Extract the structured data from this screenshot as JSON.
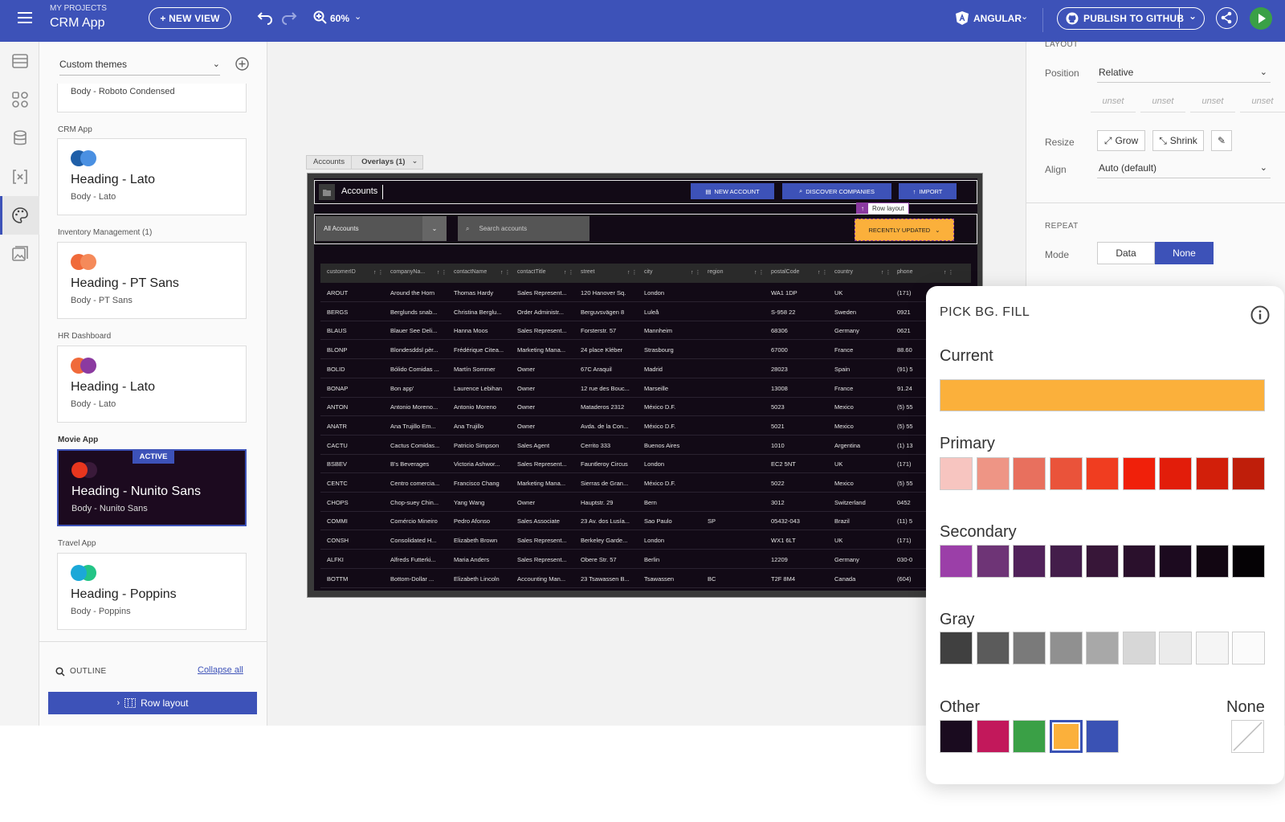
{
  "header": {
    "project_label": "MY PROJECTS",
    "app_name": "CRM App",
    "new_view": "+ NEW VIEW",
    "zoom": "60%",
    "framework": "ANGULAR",
    "publish": "PUBLISH TO GITHUB"
  },
  "left_panel": {
    "theme_select": "Custom themes",
    "partial_card_body": "Body - Roboto Condensed",
    "themes": [
      {
        "label": "CRM App",
        "heading": "Heading - Lato",
        "body": "Body - Lato",
        "c1": "#1f5fa8",
        "c2": "#4a90e2"
      },
      {
        "label": "Inventory Management (1)",
        "heading": "Heading - PT Sans",
        "body": "Body - PT Sans",
        "c1": "#f06a3a",
        "c2": "#f58a5a"
      },
      {
        "label": "HR Dashboard",
        "heading": "Heading - Lato",
        "body": "Body - Lato",
        "c1": "#f06a3a",
        "c2": "#8b3aa0"
      },
      {
        "label": "Movie App",
        "heading": "Heading - Nunito Sans",
        "body": "Body - Nunito Sans",
        "c1": "#e8361e",
        "c2": "#3a1a3a",
        "badge": "ACTIVE"
      },
      {
        "label": "Travel App",
        "heading": "Heading - Poppins",
        "body": "Body - Poppins",
        "c1": "#1ba8d8",
        "c2": "#23c486"
      }
    ],
    "outline_label": "OUTLINE",
    "collapse_all": "Collapse all",
    "row_layout": "Row layout"
  },
  "canvas": {
    "breadcrumb_1": "Accounts",
    "breadcrumb_2": "Overlays (1)",
    "app_title": "Accounts",
    "new_account": "NEW ACCOUNT",
    "discover": "DISCOVER COMPANIES",
    "import": "IMPORT",
    "row_layout_tag": "Row layout",
    "filter_select": "All Accounts",
    "search_placeholder": "Search accounts",
    "recently_updated": "RECENTLY UPDATED",
    "columns": [
      "customerID",
      "companyNa...",
      "contactName",
      "contactTitle",
      "street",
      "city",
      "region",
      "postalCode",
      "country",
      "phone"
    ],
    "rows": [
      [
        "AROUT",
        "Around the Horn",
        "Thomas Hardy",
        "Sales Represent...",
        "120 Hanover Sq.",
        "London",
        "",
        "WA1 1DP",
        "UK",
        "(171)"
      ],
      [
        "BERGS",
        "Berglunds snab...",
        "Christina Berglu...",
        "Order Administr...",
        "Berguvsvägen 8",
        "Luleå",
        "",
        "S-958 22",
        "Sweden",
        "0921"
      ],
      [
        "BLAUS",
        "Blauer See Deli...",
        "Hanna Moos",
        "Sales Represent...",
        "Forsterstr. 57",
        "Mannheim",
        "",
        "68306",
        "Germany",
        "0621"
      ],
      [
        "BLONP",
        "Blondesddsl pèr...",
        "Frédérique Citea...",
        "Marketing Mana...",
        "24 place Kléber",
        "Strasbourg",
        "",
        "67000",
        "France",
        "88.60"
      ],
      [
        "BOLID",
        "Bólido Comidas ...",
        "Martín Sommer",
        "Owner",
        "67C Araquil",
        "Madrid",
        "",
        "28023",
        "Spain",
        "(91) 5"
      ],
      [
        "BONAP",
        "Bon app'",
        "Laurence Lebihan",
        "Owner",
        "12 rue des Bouc...",
        "Marseille",
        "",
        "13008",
        "France",
        "91.24"
      ],
      [
        "ANTON",
        "Antonio Moreno...",
        "Antonio Moreno",
        "Owner",
        "Mataderos 2312",
        "México D.F.",
        "",
        "5023",
        "Mexico",
        "(5) 55"
      ],
      [
        "ANATR",
        "Ana Trujillo Em...",
        "Ana Trujillo",
        "Owner",
        "Avda. de la Con...",
        "México D.F.",
        "",
        "5021",
        "Mexico",
        "(5) 55"
      ],
      [
        "CACTU",
        "Cactus Comidas...",
        "Patricio Simpson",
        "Sales Agent",
        "Cerrito 333",
        "Buenos Aires",
        "",
        "1010",
        "Argentina",
        "(1) 13"
      ],
      [
        "BSBEV",
        "B's Beverages",
        "Victoria Ashwor...",
        "Sales Represent...",
        "Fauntleroy Circus",
        "London",
        "",
        "EC2 5NT",
        "UK",
        "(171)"
      ],
      [
        "CENTC",
        "Centro comercia...",
        "Francisco Chang",
        "Marketing Mana...",
        "Sierras de Gran...",
        "México D.F.",
        "",
        "5022",
        "Mexico",
        "(5) 55"
      ],
      [
        "CHOPS",
        "Chop-suey Chin...",
        "Yang Wang",
        "Owner",
        "Hauptstr. 29",
        "Bern",
        "",
        "3012",
        "Switzerland",
        "0452"
      ],
      [
        "COMMI",
        "Comércio Mineiro",
        "Pedro Afonso",
        "Sales Associate",
        "23 Av. dos Lusía...",
        "Sao Paulo",
        "SP",
        "05432-043",
        "Brazil",
        "(11) 5"
      ],
      [
        "CONSH",
        "Consolidated H...",
        "Elizabeth Brown",
        "Sales Represent...",
        "Berkeley Garde...",
        "London",
        "",
        "WX1 6LT",
        "UK",
        "(171)"
      ],
      [
        "ALFKI",
        "Alfreds Futterki...",
        "Maria Anders",
        "Sales Represent...",
        "Obere Str. 57",
        "Berlin",
        "",
        "12209",
        "Germany",
        "030-0"
      ],
      [
        "BOTTM",
        "Bottom-Dollar ...",
        "Elizabeth Lincoln",
        "Accounting Man...",
        "23 Tsawassen B...",
        "Tsawassen",
        "BC",
        "T2F 8M4",
        "Canada",
        "(604)"
      ]
    ]
  },
  "right_panel": {
    "layout_label": "LAYOUT",
    "position_label": "Position",
    "position_value": "Relative",
    "unset": [
      "unset",
      "unset",
      "unset",
      "unset"
    ],
    "resize_label": "Resize",
    "grow": "Grow",
    "shrink": "Shrink",
    "align_label": "Align",
    "align_value": "Auto (default)",
    "repeat_label": "REPEAT",
    "mode_label": "Mode",
    "mode_data": "Data",
    "mode_none": "None"
  },
  "popover": {
    "title": "PICK BG. FILL",
    "current_label": "Current",
    "current_color": "#fbb03b",
    "primary_label": "Primary",
    "secondary_label": "Secondary",
    "gray_label": "Gray",
    "other_label": "Other",
    "none_label": "None",
    "primary": [
      "#f7c5c0",
      "#ee9585",
      "#e8705e",
      "#ea533a",
      "#f03d20",
      "#f0200a",
      "#e21d0a",
      "#d21f0a",
      "#bf1e0a"
    ],
    "secondary": [
      "#9b3fa8",
      "#6e3476",
      "#51225a",
      "#431d4a",
      "#371638",
      "#2a102c",
      "#1c0a1f",
      "#120612",
      "#050205"
    ],
    "gray": [
      "#404040",
      "#5b5b5b",
      "#7a7a7a",
      "#909090",
      "#a8a8a8",
      "#d7d7d7",
      "#ebebeb",
      "#f5f5f5",
      "#fbfbfb"
    ],
    "other": [
      "#1a0b1f",
      "#c2185b",
      "#3aa046",
      "#fbb03b",
      "#3a52b4"
    ]
  }
}
